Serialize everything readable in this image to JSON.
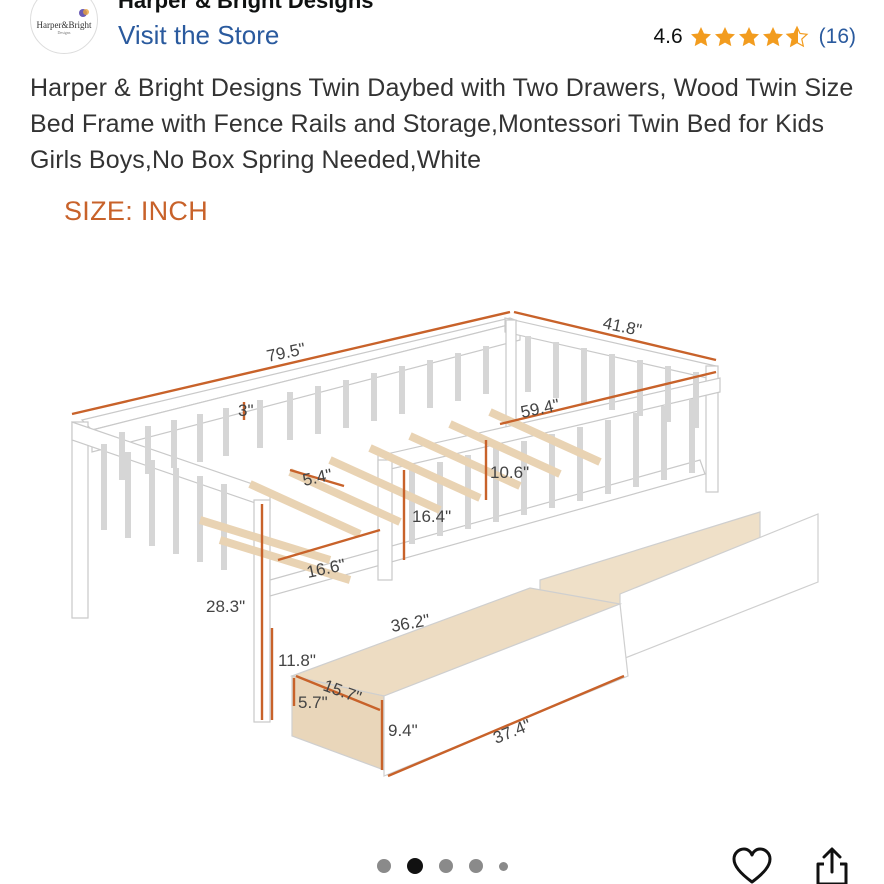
{
  "store": {
    "logo_text": "Harper&Bright",
    "logo_sub": "Designs",
    "brand_name": "Harper & Bright Designs",
    "visit_link": "Visit the Store"
  },
  "rating": {
    "value": "4.6",
    "stars": 4.6,
    "count": "(16)",
    "star_color": "#f29c1f"
  },
  "product": {
    "title": "Harper & Bright Designs Twin Daybed with Two Drawers, Wood Twin Size Bed Frame with Fence Rails and Storage,Montessori Twin Bed for Kids Girls Boys,No Box Spring Needed,White"
  },
  "image": {
    "size_label": "SIZE: INCH",
    "dimensions": {
      "length": "79.5\"",
      "width": "41.8\"",
      "rail_gap": "3\"",
      "inner_length": "59.4\"",
      "slat_gap": "5.4\"",
      "rail_height": "10.6\"",
      "guard_height": "16.4\"",
      "slat_width": "16.6\"",
      "total_height": "28.3\"",
      "clearance": "11.8\"",
      "drawer_inner_length": "36.2\"",
      "drawer_inner_width": "15.7\"",
      "drawer_inner_height": "5.7\"",
      "drawer_height": "9.4\"",
      "drawer_length": "37.4\""
    },
    "accent_color": "#c8622a"
  },
  "carousel": {
    "count": 5,
    "active_index": 1
  },
  "actions": {
    "favorite_icon": "heart-icon",
    "share_icon": "share-icon"
  }
}
